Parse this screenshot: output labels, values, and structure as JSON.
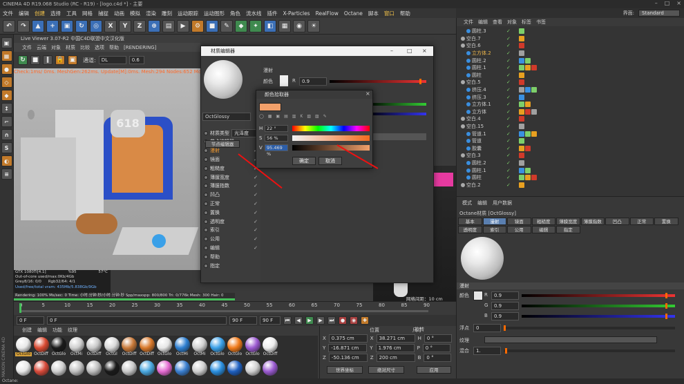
{
  "app": {
    "title": "CINEMA 4D R19.068 Studio (RC - R19) - [logo.c4d *] - 主要",
    "interface_label": "界面:",
    "interface_value": "Standard"
  },
  "menubar": [
    "文件",
    "编辑",
    "创建",
    "选择",
    "工具",
    "网格",
    "捕捉",
    "动画",
    "模拟",
    "渲染",
    "雕刻",
    "运动跟踪",
    "运动图形",
    "角色",
    "流水线",
    "插件",
    "X-Particles",
    "RealFlow",
    "Octane",
    "脚本",
    "窗口",
    "帮助"
  ],
  "viewer": {
    "title": "Live Viewer 3.07-R2 中国C4D联盟中文汉化版",
    "menu": [
      "文件",
      "云端",
      "对象",
      "材质",
      "比较",
      "选项",
      "帮助",
      "[RENDERING]"
    ],
    "channel_label": "通道:",
    "channel_value": "DL",
    "value": "0.6",
    "status": "Check:1ms/ 0ms. MeshGen:262ms. Update[M]:0ms. Mesh:294 Nodes:652 Movable:0"
  },
  "stats": {
    "gpu": "GTX 1080Ti[4.1]",
    "gpu_pct": "%95",
    "gpu_temp": "57°C",
    "ooc": "Out-of-core used/max:0Kb/4Gb",
    "grey": "Grey8/16: 0/0",
    "rgb": "Rgb32/64: 4/1",
    "vram": "Used/free/total vram: 435Mb/5.838Gb/9Gb",
    "render_line": "Rendering: 100%  Ms/sec: 0  Time: 小时:分钟:秒/小时:分钟:秒  Spp/maxspp: 800/800  Tri: 0/776k  Mesh: 300  Hair: 0"
  },
  "timeline": {
    "ticks": [
      "0",
      "5",
      "10",
      "15",
      "20",
      "25",
      "30",
      "35",
      "40",
      "45",
      "50",
      "55",
      "60",
      "65",
      "70",
      "75",
      "80",
      "85",
      "90"
    ],
    "start": "0 F",
    "current": "0 F",
    "end": "90 F",
    "end2": "90 F"
  },
  "material_manager": {
    "menu": [
      "创建",
      "编辑",
      "功能",
      "纹理"
    ],
    "maxon": "MAXON CINEMA 4D",
    "row1": [
      {
        "label": "OctGlo",
        "color": "#e8e8e8"
      },
      {
        "label": "OctDiff",
        "color": "#d94a32"
      },
      {
        "label": "OctGlo",
        "color": "#1a1a1a"
      },
      {
        "label": "OctMi",
        "color": "#cfcfcf"
      },
      {
        "label": "OctDiff",
        "color": "#c8c8c8"
      },
      {
        "label": "OctGl",
        "color": "#d9d9d9"
      },
      {
        "label": "OctDiff",
        "color": "#c97a3a"
      },
      {
        "label": "OctDiff",
        "color": "#d8782a"
      },
      {
        "label": "OctGlo",
        "color": "#e6e6e6"
      },
      {
        "label": "OctMi",
        "color": "#2d7fd1"
      },
      {
        "label": "OctMi",
        "color": "#d0d0d0"
      },
      {
        "label": "OctGlo",
        "color": "#3aa0e8"
      },
      {
        "label": "OctGlo",
        "color": "#f07a1a"
      },
      {
        "label": "OctGlo",
        "color": "#9b59d0"
      },
      {
        "label": "OctDiff",
        "color": "#ececec"
      }
    ],
    "row2": [
      {
        "color": "#e8e8e8"
      },
      {
        "color": "#d84a3a"
      },
      {
        "color": "#d0d0d0"
      },
      {
        "color": "#c0c0c0"
      },
      {
        "color": "#bdbdbd"
      },
      {
        "color": "#1a1a1a"
      },
      {
        "color": "#c9c9c9"
      },
      {
        "color": "#4aa8e0"
      },
      {
        "color": "#e46ad0"
      },
      {
        "color": "#3a7fd0"
      },
      {
        "color": "#cfcfcf"
      },
      {
        "color": "#2a8fe0"
      },
      {
        "color": "#1d5fc0"
      },
      {
        "color": "#d0d0d0"
      },
      {
        "color": "#9a5ad0"
      }
    ]
  },
  "coords": {
    "headers": [
      "位置",
      "尺寸",
      "旋转"
    ],
    "rows": [
      {
        "axis": "X",
        "pos": "0.375 cm",
        "size": "38.271 cm",
        "rot_axis": "H",
        "rot": "0 °"
      },
      {
        "axis": "Y",
        "pos": "-16.871 cm",
        "size": "1.976 cm",
        "rot_axis": "P",
        "rot": "0 °"
      },
      {
        "axis": "Z",
        "pos": "-50.136 cm",
        "size": "200 cm",
        "rot_axis": "B",
        "rot": "0 °"
      }
    ],
    "world": "世界坐标",
    "abs": "绝对尺寸",
    "apply": "应用"
  },
  "object_manager": {
    "menu": [
      "文件",
      "编辑",
      "查看",
      "对象",
      "标签",
      "书签"
    ],
    "rows": [
      {
        "name": "圆柱.3",
        "indent": 1,
        "hl": false
      },
      {
        "name": "空白.7",
        "indent": 0,
        "hl": false
      },
      {
        "name": "空白.6",
        "indent": 0,
        "hl": false
      },
      {
        "name": "立方体.2",
        "indent": 1,
        "hl": true
      },
      {
        "name": "圆柱.2",
        "indent": 1,
        "hl": false
      },
      {
        "name": "圆柱.1",
        "indent": 1,
        "hl": false
      },
      {
        "name": "圆柱",
        "indent": 1,
        "hl": false
      },
      {
        "name": "空白.5",
        "indent": 0,
        "hl": false
      },
      {
        "name": "挤压.4",
        "indent": 1,
        "hl": false
      },
      {
        "name": "挤压.3",
        "indent": 1,
        "hl": false
      },
      {
        "name": "立方体.1",
        "indent": 1,
        "hl": false
      },
      {
        "name": "立方体",
        "indent": 1,
        "hl": false
      },
      {
        "name": "空白.4",
        "indent": 0,
        "hl": false
      },
      {
        "name": "空白.15",
        "indent": 0,
        "hl": false
      },
      {
        "name": "管道.1",
        "indent": 1,
        "hl": false
      },
      {
        "name": "管道",
        "indent": 1,
        "hl": false
      },
      {
        "name": "胶囊",
        "indent": 1,
        "hl": false
      },
      {
        "name": "空白.3",
        "indent": 0,
        "hl": false
      },
      {
        "name": "圆柱.2",
        "indent": 1,
        "hl": false
      },
      {
        "name": "圆柱.1",
        "indent": 1,
        "hl": false
      },
      {
        "name": "圆柱",
        "indent": 1,
        "hl": false
      },
      {
        "name": "空白.2",
        "indent": 0,
        "hl": false
      }
    ]
  },
  "attributes": {
    "menu": [
      "模式",
      "编辑",
      "用户数据"
    ],
    "title": "Octane材质 [OctGlossy]",
    "tabs_row1": [
      "基本",
      "漫射",
      "镜面",
      "粗糙度",
      "薄膜宽度",
      "薄膜指数",
      "凹凸",
      "正常",
      "置换"
    ],
    "tabs_row2": [
      "透明度",
      "索引",
      "公用",
      "编辑",
      "指定"
    ],
    "active_tab": "漫射",
    "section": "漫射",
    "color_label": "颜色",
    "r_label": "R",
    "r_val": "0.9",
    "g_label": "G",
    "g_val": "0.9",
    "b_label": "B",
    "b_val": "0.9",
    "float_label": "浮点",
    "float_val": "0",
    "texture_label": "纹理",
    "mix_label": "混合",
    "mix_val": "1."
  },
  "material_editor": {
    "title": "材质编辑器",
    "name": "OctGlossy",
    "items": [
      {
        "label": "材质类型",
        "check": false,
        "sel": false
      },
      {
        "label": "节点编辑器",
        "check": false,
        "sel": false
      },
      {
        "label": "漫射",
        "check": true,
        "sel": true
      },
      {
        "label": "镜面",
        "check": true,
        "sel": false
      },
      {
        "label": "粗糙度",
        "check": true,
        "sel": false
      },
      {
        "label": "薄膜宽度",
        "check": true,
        "sel": false
      },
      {
        "label": "薄膜指数",
        "check": true,
        "sel": false
      },
      {
        "label": "凹凸",
        "check": true,
        "sel": false
      },
      {
        "label": "正常",
        "check": true,
        "sel": false
      },
      {
        "label": "置换",
        "check": true,
        "sel": false
      },
      {
        "label": "透明度",
        "check": true,
        "sel": false
      },
      {
        "label": "索引",
        "check": true,
        "sel": false
      },
      {
        "label": "公用",
        "check": true,
        "sel": false
      },
      {
        "label": "编辑",
        "check": true,
        "sel": false
      },
      {
        "label": "帮助",
        "check": false,
        "sel": false
      },
      {
        "label": "指定",
        "check": false,
        "sel": false
      }
    ],
    "type_value": "光泽度",
    "node_editor_btn": "节点编辑器",
    "section": "漫射",
    "color_label": "颜色",
    "r_label": "R",
    "r_val": "0.9"
  },
  "color_picker": {
    "title": "颜色拾取器",
    "h_label": "H",
    "h_val": "22 °",
    "s_label": "S",
    "s_val": "56 %",
    "v_label": "V",
    "v_val": "95.469 %",
    "ok": "确定",
    "cancel": "取消",
    "swatch": "#f2a06a"
  },
  "status_bar": "Octane:",
  "viewport_label": "cm",
  "viewport_right_label": "网格间距：10 cm"
}
